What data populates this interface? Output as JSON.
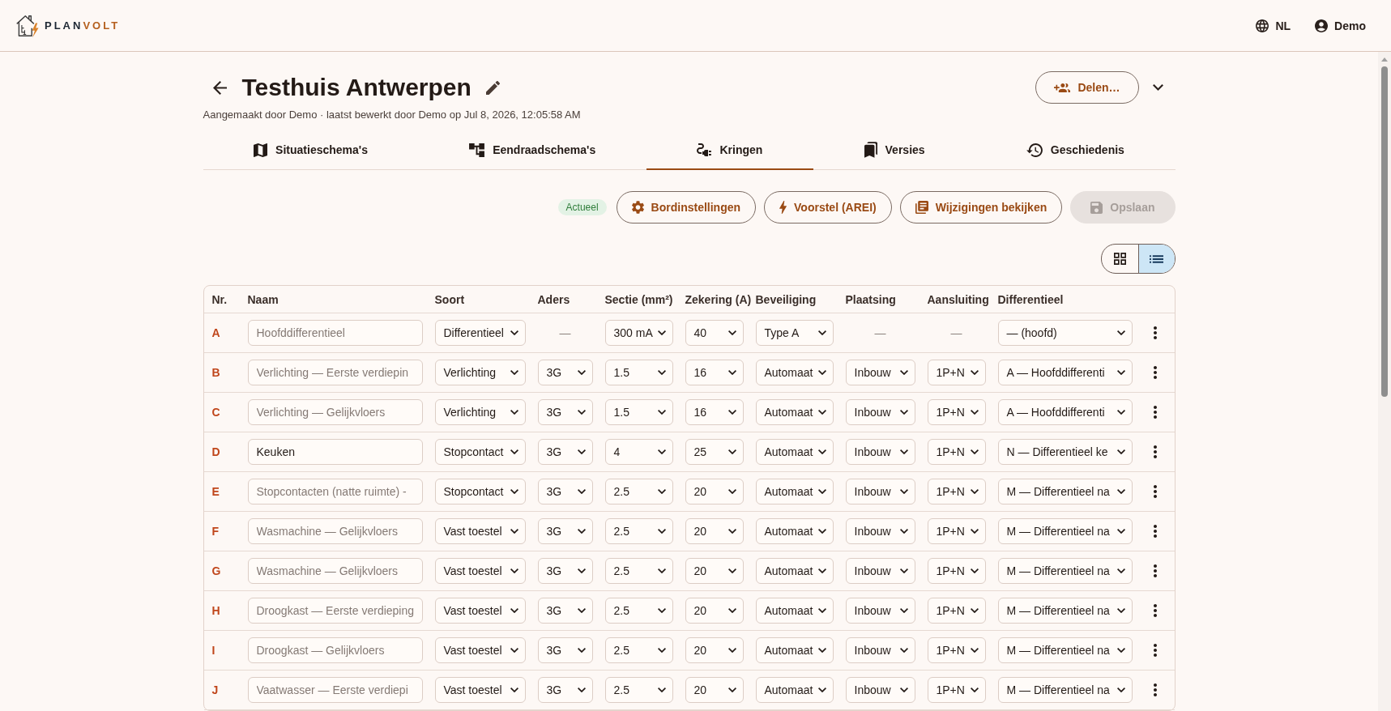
{
  "header": {
    "logo": [
      "PLAN",
      "VOLT"
    ],
    "language": "NL",
    "user": "Demo"
  },
  "project": {
    "title": "Testhuis Antwerpen",
    "meta": "Aangemaakt door Demo · laatst bewerkt door Demo op Jul 8, 2026, 12:05:58 AM",
    "share_button": "Delen…"
  },
  "tabs": [
    {
      "label": "Situatieschema's",
      "selected": false
    },
    {
      "label": "Eendraadschema's",
      "selected": false
    },
    {
      "label": "Kringen",
      "selected": true
    },
    {
      "label": "Versies",
      "selected": false
    },
    {
      "label": "Geschiedenis",
      "selected": false
    }
  ],
  "toolbar": {
    "status": "Actueel",
    "buttons": [
      {
        "label": "Bordinstellingen",
        "disabled": false
      },
      {
        "label": "Voorstel (AREI)",
        "disabled": false
      },
      {
        "label": "Wijzigingen bekijken",
        "disabled": false
      },
      {
        "label": "Opslaan",
        "disabled": true
      }
    ]
  },
  "view_toggle": [
    {
      "selected": false
    },
    {
      "selected": true
    }
  ],
  "table": {
    "columns": [
      "Nr.",
      "Naam",
      "Soort",
      "Aders",
      "Sectie (mm²)",
      "Zekering (A)",
      "Beveiliging",
      "Plaatsing",
      "Aansluiting",
      "Differentieel"
    ],
    "rows": [
      {
        "cells": [
          {
            "kind": "letter",
            "value": "A"
          },
          {
            "kind": "input",
            "placeholder": "Hoofddifferentieel"
          },
          {
            "kind": "select",
            "value": "Differentieel"
          },
          {
            "kind": "dash",
            "value": "—"
          },
          {
            "kind": "select",
            "value": "300 mA"
          },
          {
            "kind": "select",
            "value": "40"
          },
          {
            "kind": "select",
            "value": "Type A"
          },
          {
            "kind": "dash",
            "value": "—"
          },
          {
            "kind": "dash",
            "value": "—"
          },
          {
            "kind": "select",
            "value": "— (hoofd)"
          }
        ]
      },
      {
        "cells": [
          {
            "kind": "letter",
            "value": "B"
          },
          {
            "kind": "input",
            "placeholder": "Verlichting — Eerste verdiepin"
          },
          {
            "kind": "select",
            "value": "Verlichting"
          },
          {
            "kind": "select",
            "value": "3G"
          },
          {
            "kind": "select",
            "value": "1.5"
          },
          {
            "kind": "select",
            "value": "16"
          },
          {
            "kind": "select",
            "value": "Automaat"
          },
          {
            "kind": "select",
            "value": "Inbouw"
          },
          {
            "kind": "select",
            "value": "1P+N"
          },
          {
            "kind": "select",
            "value": "A — Hoofddifferenti"
          }
        ]
      },
      {
        "cells": [
          {
            "kind": "letter",
            "value": "C"
          },
          {
            "kind": "input",
            "placeholder": "Verlichting — Gelijkvloers"
          },
          {
            "kind": "select",
            "value": "Verlichting"
          },
          {
            "kind": "select",
            "value": "3G"
          },
          {
            "kind": "select",
            "value": "1.5"
          },
          {
            "kind": "select",
            "value": "16"
          },
          {
            "kind": "select",
            "value": "Automaat"
          },
          {
            "kind": "select",
            "value": "Inbouw"
          },
          {
            "kind": "select",
            "value": "1P+N"
          },
          {
            "kind": "select",
            "value": "A — Hoofddifferenti"
          }
        ]
      },
      {
        "cells": [
          {
            "kind": "letter",
            "value": "D"
          },
          {
            "kind": "input",
            "value": "Keuken"
          },
          {
            "kind": "select",
            "value": "Stopcontact"
          },
          {
            "kind": "select",
            "value": "3G"
          },
          {
            "kind": "select",
            "value": "4"
          },
          {
            "kind": "select",
            "value": "25"
          },
          {
            "kind": "select",
            "value": "Automaat"
          },
          {
            "kind": "select",
            "value": "Inbouw"
          },
          {
            "kind": "select",
            "value": "1P+N"
          },
          {
            "kind": "select",
            "value": "N — Differentieel ke"
          }
        ]
      },
      {
        "cells": [
          {
            "kind": "letter",
            "value": "E"
          },
          {
            "kind": "input",
            "placeholder": "Stopcontacten (natte ruimte) -"
          },
          {
            "kind": "select",
            "value": "Stopcontact"
          },
          {
            "kind": "select",
            "value": "3G"
          },
          {
            "kind": "select",
            "value": "2.5"
          },
          {
            "kind": "select",
            "value": "20"
          },
          {
            "kind": "select",
            "value": "Automaat"
          },
          {
            "kind": "select",
            "value": "Inbouw"
          },
          {
            "kind": "select",
            "value": "1P+N"
          },
          {
            "kind": "select",
            "value": "M — Differentieel na"
          }
        ]
      },
      {
        "cells": [
          {
            "kind": "letter",
            "value": "F"
          },
          {
            "kind": "input",
            "placeholder": "Wasmachine — Gelijkvloers"
          },
          {
            "kind": "select",
            "value": "Vast toestel"
          },
          {
            "kind": "select",
            "value": "3G"
          },
          {
            "kind": "select",
            "value": "2.5"
          },
          {
            "kind": "select",
            "value": "20"
          },
          {
            "kind": "select",
            "value": "Automaat"
          },
          {
            "kind": "select",
            "value": "Inbouw"
          },
          {
            "kind": "select",
            "value": "1P+N"
          },
          {
            "kind": "select",
            "value": "M — Differentieel na"
          }
        ]
      },
      {
        "cells": [
          {
            "kind": "letter",
            "value": "G"
          },
          {
            "kind": "input",
            "placeholder": "Wasmachine — Gelijkvloers"
          },
          {
            "kind": "select",
            "value": "Vast toestel"
          },
          {
            "kind": "select",
            "value": "3G"
          },
          {
            "kind": "select",
            "value": "2.5"
          },
          {
            "kind": "select",
            "value": "20"
          },
          {
            "kind": "select",
            "value": "Automaat"
          },
          {
            "kind": "select",
            "value": "Inbouw"
          },
          {
            "kind": "select",
            "value": "1P+N"
          },
          {
            "kind": "select",
            "value": "M — Differentieel na"
          }
        ]
      },
      {
        "cells": [
          {
            "kind": "letter",
            "value": "H"
          },
          {
            "kind": "input",
            "placeholder": "Droogkast — Eerste verdieping"
          },
          {
            "kind": "select",
            "value": "Vast toestel"
          },
          {
            "kind": "select",
            "value": "3G"
          },
          {
            "kind": "select",
            "value": "2.5"
          },
          {
            "kind": "select",
            "value": "20"
          },
          {
            "kind": "select",
            "value": "Automaat"
          },
          {
            "kind": "select",
            "value": "Inbouw"
          },
          {
            "kind": "select",
            "value": "1P+N"
          },
          {
            "kind": "select",
            "value": "M — Differentieel na"
          }
        ]
      },
      {
        "cells": [
          {
            "kind": "letter",
            "value": "I"
          },
          {
            "kind": "input",
            "placeholder": "Droogkast — Gelijkvloers"
          },
          {
            "kind": "select",
            "value": "Vast toestel"
          },
          {
            "kind": "select",
            "value": "3G"
          },
          {
            "kind": "select",
            "value": "2.5"
          },
          {
            "kind": "select",
            "value": "20"
          },
          {
            "kind": "select",
            "value": "Automaat"
          },
          {
            "kind": "select",
            "value": "Inbouw"
          },
          {
            "kind": "select",
            "value": "1P+N"
          },
          {
            "kind": "select",
            "value": "M — Differentieel na"
          }
        ]
      },
      {
        "cells": [
          {
            "kind": "letter",
            "value": "J"
          },
          {
            "kind": "input",
            "placeholder": "Vaatwasser — Eerste verdiepi"
          },
          {
            "kind": "select",
            "value": "Vast toestel"
          },
          {
            "kind": "select",
            "value": "3G"
          },
          {
            "kind": "select",
            "value": "2.5"
          },
          {
            "kind": "select",
            "value": "20"
          },
          {
            "kind": "select",
            "value": "Automaat"
          },
          {
            "kind": "select",
            "value": "Inbouw"
          },
          {
            "kind": "select",
            "value": "1P+N"
          },
          {
            "kind": "select",
            "value": "M — Differentieel na"
          }
        ]
      }
    ]
  }
}
